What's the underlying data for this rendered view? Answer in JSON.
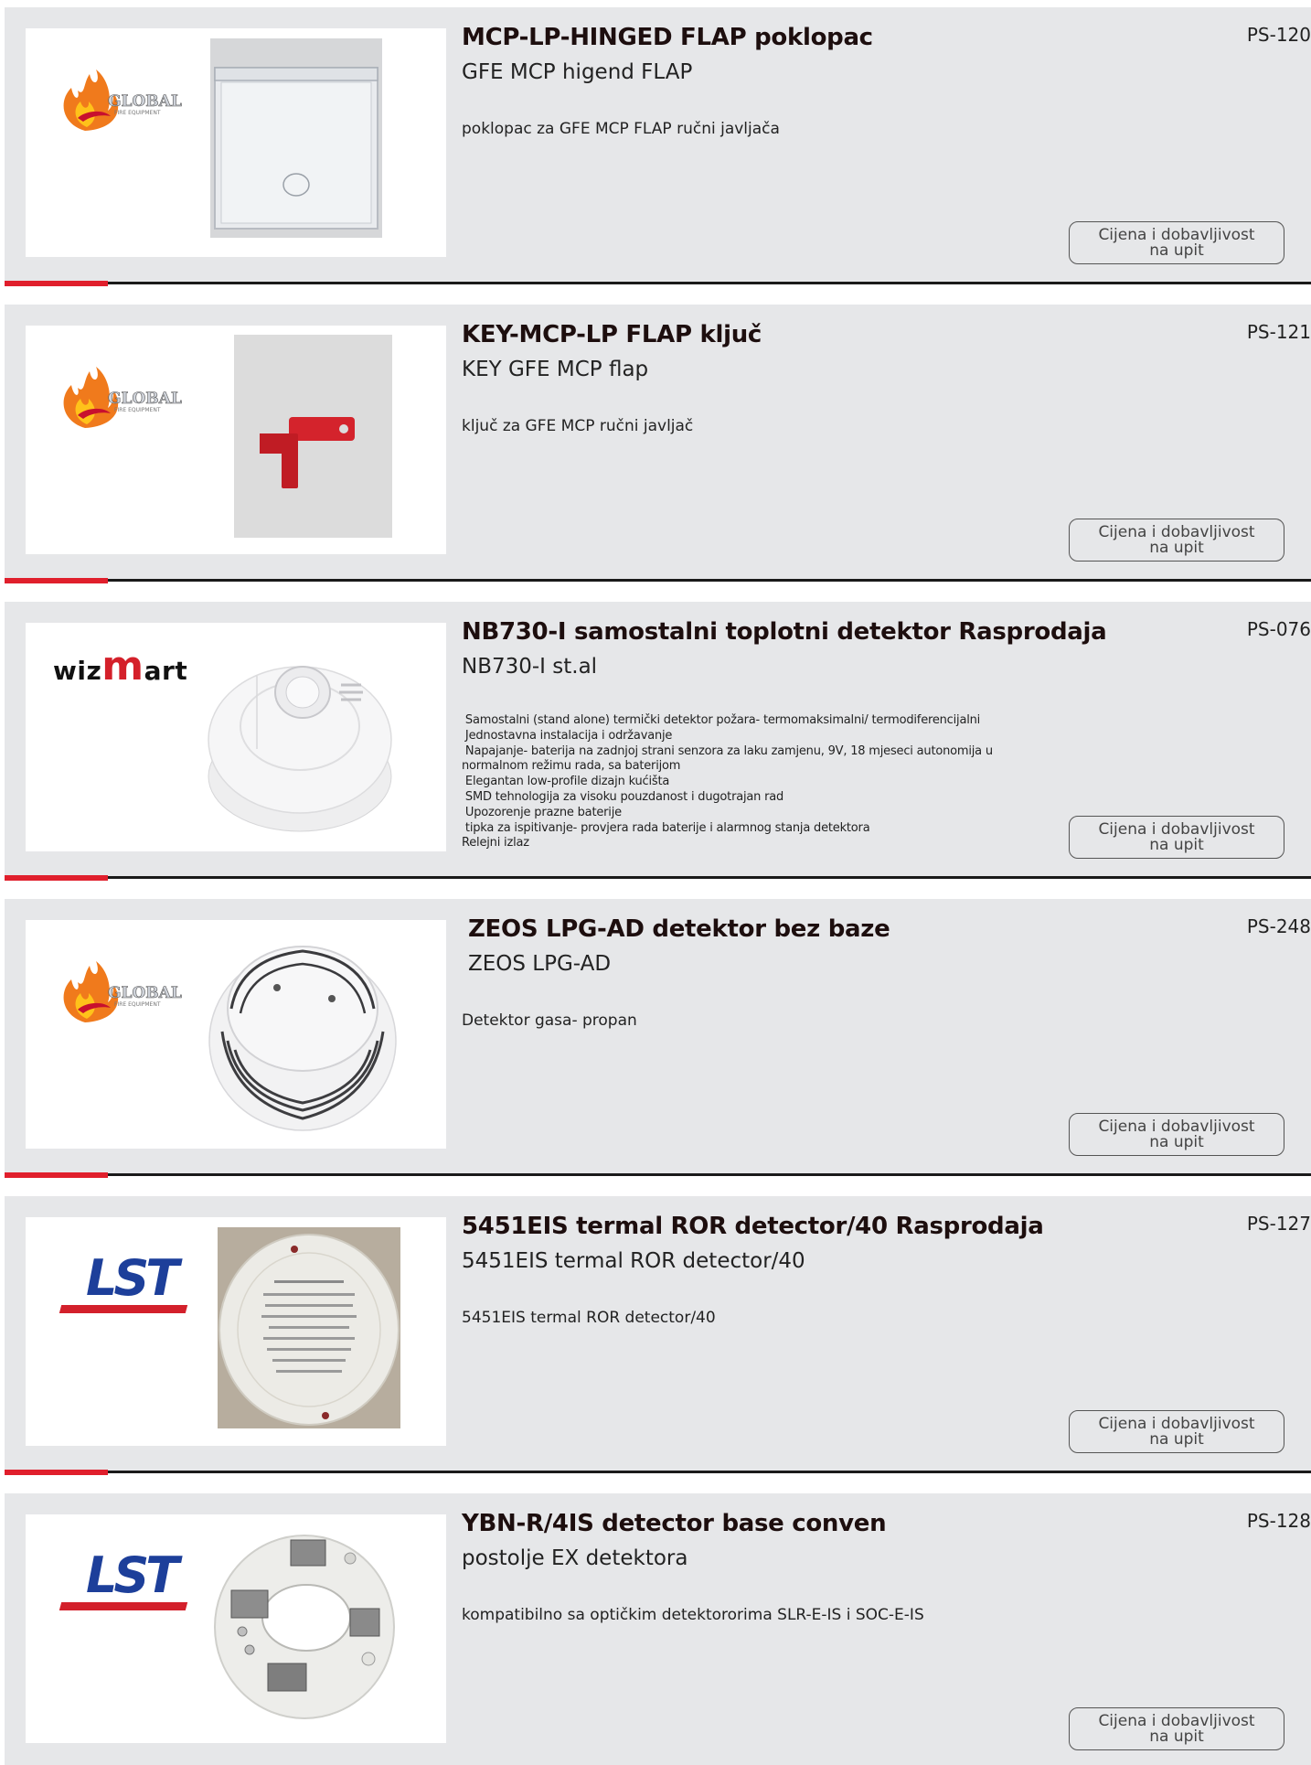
{
  "products": [
    {
      "title": "MCP-LP-HINGED FLAP poklopac",
      "subtitle": "GFE MCP higend FLAP",
      "code": "PS-120",
      "description": "poklopac za GFE MCP FLAP ručni javljača",
      "brand_icon": "global-fire-equipment-logo",
      "button_line1": "Cijena i dobavljivost",
      "button_line2": "na upit"
    },
    {
      "title": "KEY-MCP-LP FLAP ključ",
      "subtitle": "KEY GFE MCP flap",
      "code": "PS-121",
      "description": "ključ  za GFE MCP  ručni javljač",
      "brand_icon": "global-fire-equipment-logo",
      "button_line1": "Cijena i dobavljivost",
      "button_line2": "na upit"
    },
    {
      "title": "NB730-I samostalni toplotni detektor Rasprodaja",
      "subtitle": "NB730-I st.al",
      "code": "PS-076",
      "description": " Samostalni (stand alone) termički detektor požara- termomaksimalni/ termodiferencijalni\n Jednostavna instalacija i održavanje\n Napajanje- baterija na zadnjoj strani senzora za laku zamjenu, 9V, 18 mjeseci autonomija u\nnormalnom režimu rada, sa baterijom\n Elegantan low-profile dizajn kućišta\n SMD tehnologija za visoku pouzdanost i dugotrajan rad\n Upozorenje prazne baterije\n tipka za ispitivanje- provjera rada baterije i alarmnog stanja detektora\nRelejni izlaz",
      "brand_text_a": "wiz",
      "brand_text_b": "m",
      "brand_text_c": "art",
      "button_line1": "Cijena i dobavljivost",
      "button_line2": "na upit"
    },
    {
      "title": "ZEOS LPG-AD  detektor bez baze",
      "subtitle": "ZEOS LPG-AD",
      "code": "PS-248",
      "description": "Detektor gasa- propan",
      "brand_icon": "global-fire-equipment-logo",
      "button_line1": "Cijena i dobavljivost",
      "button_line2": "na upit"
    },
    {
      "title": "5451EIS termal ROR detector/40 Rasprodaja",
      "subtitle": "5451EIS termal ROR detector/40",
      "code": "PS-127",
      "description": "5451EIS termal ROR detector/40",
      "brand_text": "LST",
      "button_line1": "Cijena i dobavljivost",
      "button_line2": "na upit"
    },
    {
      "title": "YBN-R/4IS detector base conven",
      "subtitle": "postolje EX detektora",
      "code": "PS-128",
      "description": "kompatibilno sa optičkim detektororima SLR-E-IS i SOC-E-IS",
      "brand_text": "LST",
      "button_line1": "Cijena i dobavljivost",
      "button_line2": "na upit"
    }
  ],
  "logo_texts": {
    "global": "GLOBAL",
    "global_sub": "FIRE EQUIPMENT"
  },
  "colors": {
    "accent_red": "#e01f2c",
    "card_bg": "#e6e7e9",
    "lst_blue": "#1d3f9a"
  }
}
